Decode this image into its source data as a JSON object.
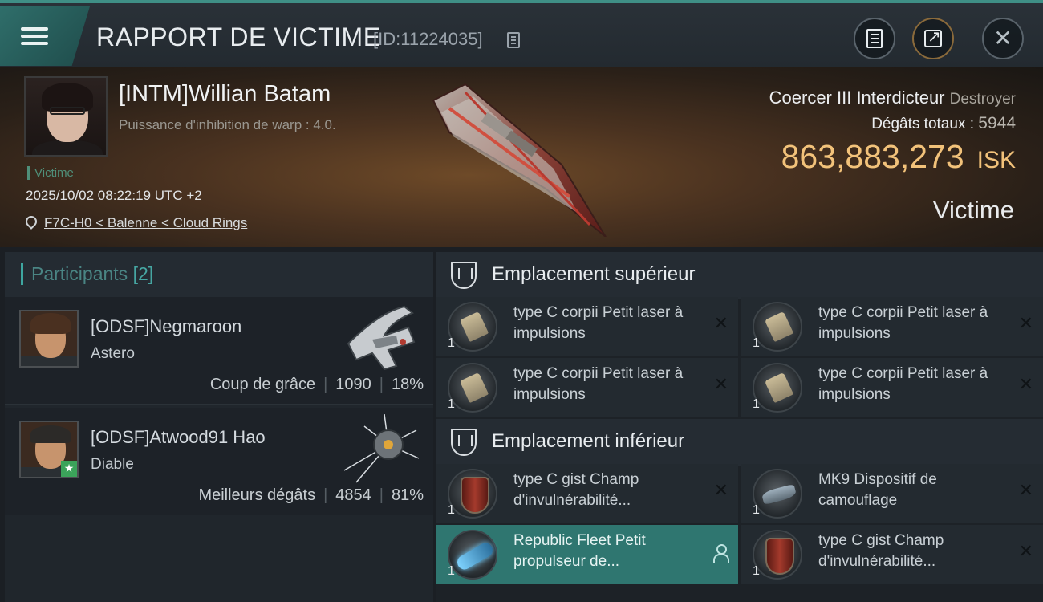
{
  "header": {
    "title": "RAPPORT DE VICTIME",
    "id_label": "[ID:11224035]"
  },
  "victim": {
    "name": "[INTM]Willian Batam",
    "subtitle": "Puissance d'inhibition de warp : 4.0.",
    "tag": "Victime",
    "timestamp": "2025/10/02 08:22:19 UTC +2",
    "location": "F7C-H0 < Balenne < Cloud Rings",
    "ship_name": "Coercer III Interdicteur",
    "ship_class": "Destroyer",
    "damage_label": "Dégâts totaux :",
    "damage_value": "5944",
    "isk_value": "863,883,273",
    "isk_unit": "ISK",
    "result_label": "Victime"
  },
  "participants": {
    "title": "Participants",
    "count": "[2]",
    "list": [
      {
        "name": "[ODSF]Negmaroon",
        "ship": "Astero",
        "role": "Coup de grâce",
        "damage": "1090",
        "percent": "18%"
      },
      {
        "name": "[ODSF]Atwood91 Hao",
        "ship": "Diable",
        "role": "Meilleurs dégâts",
        "damage": "4854",
        "percent": "81%"
      }
    ]
  },
  "slots": {
    "high": {
      "title": "Emplacement supérieur",
      "modules": [
        {
          "name": "type C corpii Petit laser à impulsions",
          "qty": "1",
          "icon": "laser-icon"
        },
        {
          "name": "type C corpii Petit laser à impulsions",
          "qty": "1",
          "icon": "laser-icon"
        },
        {
          "name": "type C corpii Petit laser à impulsions",
          "qty": "1",
          "icon": "laser-icon"
        },
        {
          "name": "type C corpii Petit laser à impulsions",
          "qty": "1",
          "icon": "laser-icon"
        }
      ]
    },
    "low": {
      "title": "Emplacement inférieur",
      "modules": [
        {
          "name": "type C gist Champ d'invulnérabilité...",
          "qty": "1",
          "icon": "shield-hardener-icon"
        },
        {
          "name": "MK9 Dispositif de camouflage",
          "qty": "1",
          "icon": "cloak-icon"
        },
        {
          "name": "Republic Fleet Petit propulseur de...",
          "qty": "1",
          "icon": "thruster-icon"
        },
        {
          "name": "type C gist Champ d'invulnérabilité...",
          "qty": "1",
          "icon": "shield-hardener-icon"
        }
      ]
    }
  },
  "colors": {
    "accent": "#3ea6a0",
    "isk": "#f2c27a",
    "selected_row": "#2f7670"
  }
}
